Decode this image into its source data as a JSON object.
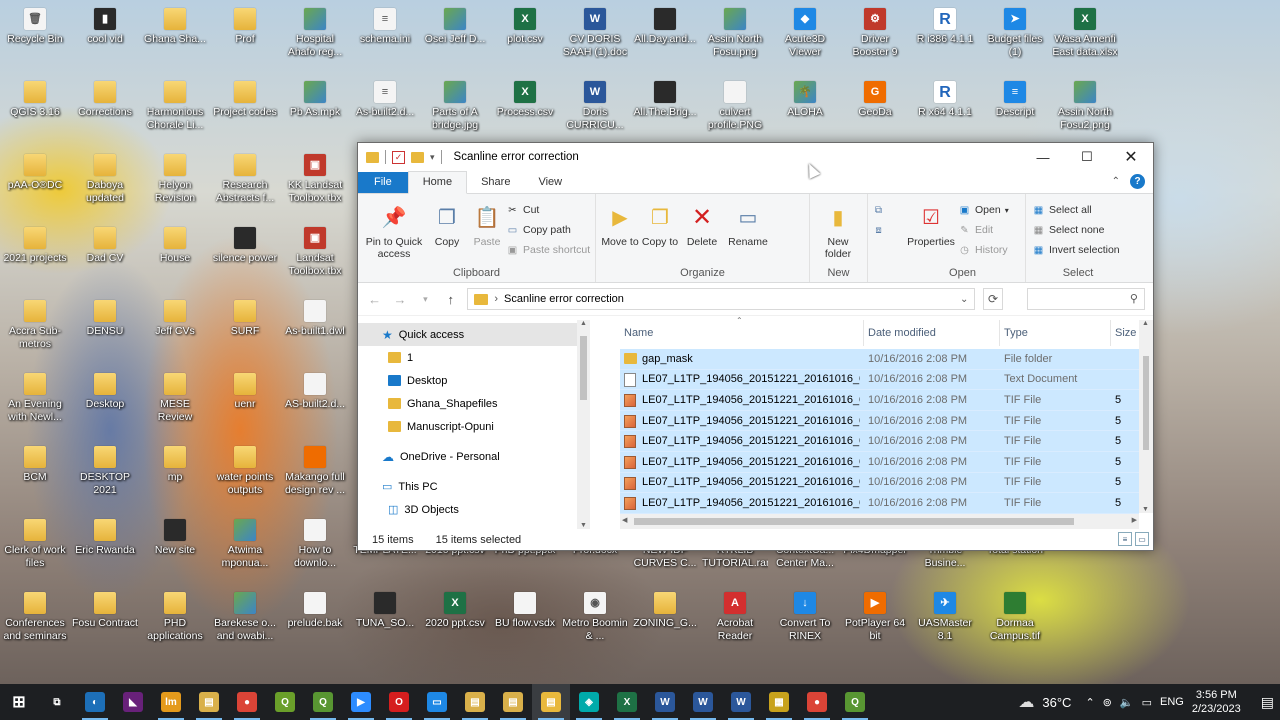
{
  "desktop": {
    "icons": [
      {
        "label": "Recycle Bin",
        "kind": "doc",
        "glyph": "🗑"
      },
      {
        "label": "cool vid",
        "kind": "dark",
        "glyph": "▮"
      },
      {
        "label": "Ghana Sha...",
        "kind": "folder",
        "glyph": ""
      },
      {
        "label": "Prof",
        "kind": "folder",
        "glyph": ""
      },
      {
        "label": "Hospital Ahafo reg...",
        "kind": "img",
        "glyph": ""
      },
      {
        "label": "schema.ini",
        "kind": "doc",
        "glyph": "≡"
      },
      {
        "label": "Osei Jeff D...",
        "kind": "img",
        "glyph": ""
      },
      {
        "label": "plot.csv",
        "kind": "excel",
        "glyph": "X"
      },
      {
        "label": "CV DORIS SAAH (1).doc",
        "kind": "word",
        "glyph": "W"
      },
      {
        "label": "All.Day.and...",
        "kind": "dark",
        "glyph": ""
      },
      {
        "label": "Assin North Fosu.png",
        "kind": "img",
        "glyph": ""
      },
      {
        "label": "Acute3D Viewer",
        "kind": "blue",
        "glyph": "◆"
      },
      {
        "label": "Driver Booster 9",
        "kind": "red",
        "glyph": "⚙"
      },
      {
        "label": "R i386 4.1.1",
        "kind": "rlogo",
        "glyph": "R"
      },
      {
        "label": "Budget files (1)",
        "kind": "blue",
        "glyph": "➤"
      },
      {
        "label": "Wasa Amenfi East data.xlsx",
        "kind": "excel",
        "glyph": "X"
      },
      {
        "label": "QGIS 3.16",
        "kind": "folder",
        "glyph": ""
      },
      {
        "label": "Corrections",
        "kind": "folder",
        "glyph": ""
      },
      {
        "label": "Harmonious Chorale Li...",
        "kind": "folder",
        "glyph": ""
      },
      {
        "label": "Project codes",
        "kind": "folder",
        "glyph": ""
      },
      {
        "label": "Pb As.mpk",
        "kind": "img",
        "glyph": ""
      },
      {
        "label": "As-built2.d...",
        "kind": "doc",
        "glyph": "≡"
      },
      {
        "label": "Parts of A bridge.jpg",
        "kind": "img",
        "glyph": ""
      },
      {
        "label": "Process.csv",
        "kind": "excel",
        "glyph": "X"
      },
      {
        "label": "Doris CURRICU...",
        "kind": "word",
        "glyph": "W"
      },
      {
        "label": "All.The.Brig...",
        "kind": "dark",
        "glyph": ""
      },
      {
        "label": "culvert profile.PNG",
        "kind": "doc",
        "glyph": ""
      },
      {
        "label": "ALOHA",
        "kind": "img",
        "glyph": "🌴"
      },
      {
        "label": "GeoDa",
        "kind": "orange",
        "glyph": "G"
      },
      {
        "label": "R x64 4.1.1",
        "kind": "rlogo",
        "glyph": "R"
      },
      {
        "label": "Descript",
        "kind": "blue",
        "glyph": "≡"
      },
      {
        "label": "Assin North Fosu2.png",
        "kind": "img",
        "glyph": ""
      },
      {
        "label": "pAA-O®DC",
        "kind": "folder",
        "glyph": ""
      },
      {
        "label": "Daboya updated",
        "kind": "folder",
        "glyph": ""
      },
      {
        "label": "Helyon Revision",
        "kind": "folder",
        "glyph": ""
      },
      {
        "label": "Research Abstracts f...",
        "kind": "folder",
        "glyph": ""
      },
      {
        "label": "KK Landsat Toolbox.tbx",
        "kind": "red",
        "glyph": "▣"
      },
      {
        "label": "2021 projects",
        "kind": "folder",
        "glyph": ""
      },
      {
        "label": "Dad CV",
        "kind": "folder",
        "glyph": ""
      },
      {
        "label": "House",
        "kind": "folder",
        "glyph": ""
      },
      {
        "label": "silence power",
        "kind": "dark",
        "glyph": ""
      },
      {
        "label": "Landsat Toolbox.tbx",
        "kind": "red",
        "glyph": "▣"
      },
      {
        "label": "Accra Sub-metros",
        "kind": "folder",
        "glyph": ""
      },
      {
        "label": "DENSU",
        "kind": "folder",
        "glyph": ""
      },
      {
        "label": "Jeff CVs",
        "kind": "folder",
        "glyph": ""
      },
      {
        "label": "SURF",
        "kind": "folder",
        "glyph": ""
      },
      {
        "label": "As-built1.dwl",
        "kind": "doc",
        "glyph": ""
      },
      {
        "label": "An Evening with Newl...",
        "kind": "folder",
        "glyph": ""
      },
      {
        "label": "Desktop",
        "kind": "folder",
        "glyph": ""
      },
      {
        "label": "MESE Review",
        "kind": "folder",
        "glyph": ""
      },
      {
        "label": "uenr",
        "kind": "folder",
        "glyph": ""
      },
      {
        "label": "AS-built2.d...",
        "kind": "doc",
        "glyph": ""
      },
      {
        "label": "BCM",
        "kind": "folder",
        "glyph": ""
      },
      {
        "label": "DESKTOP 2021",
        "kind": "folder",
        "glyph": ""
      },
      {
        "label": "mp",
        "kind": "folder",
        "glyph": ""
      },
      {
        "label": "water points outputs",
        "kind": "folder",
        "glyph": ""
      },
      {
        "label": "Makango full design rev ...",
        "kind": "orange",
        "glyph": ""
      },
      {
        "label": "Clerk of work files",
        "kind": "folder",
        "glyph": ""
      },
      {
        "label": "Eric Rwanda",
        "kind": "folder",
        "glyph": ""
      },
      {
        "label": "New site",
        "kind": "dark",
        "glyph": ""
      },
      {
        "label": "Atwima mponua...",
        "kind": "img",
        "glyph": ""
      },
      {
        "label": "How to downlo...",
        "kind": "doc",
        "glyph": ""
      },
      {
        "label": "TEMPLATE...",
        "kind": "doc",
        "glyph": ""
      },
      {
        "label": "2010 ppt.csv",
        "kind": "excel",
        "glyph": "X"
      },
      {
        "label": "PhD ppt.pptx",
        "kind": "orange",
        "glyph": "P"
      },
      {
        "label": "Prof.docx",
        "kind": "word",
        "glyph": "W"
      },
      {
        "label": "NEW IDF CURVES C...",
        "kind": "doc",
        "glyph": ""
      },
      {
        "label": "RTKLIB TUTORIAL.rar",
        "kind": "purple",
        "glyph": ""
      },
      {
        "label": "ContextCa... Center Ma...",
        "kind": "teal",
        "glyph": ""
      },
      {
        "label": "Pix4Dmapper",
        "kind": "doc",
        "glyph": ""
      },
      {
        "label": "Trimble Busine...",
        "kind": "doc",
        "glyph": ""
      },
      {
        "label": "Total station",
        "kind": "doc",
        "glyph": ""
      },
      {
        "label": "Conferences and seminars",
        "kind": "folder",
        "glyph": ""
      },
      {
        "label": "Fosu Contract",
        "kind": "folder",
        "glyph": ""
      },
      {
        "label": "PHD applications",
        "kind": "folder",
        "glyph": ""
      },
      {
        "label": "Barekese o... and owabi...",
        "kind": "img",
        "glyph": ""
      },
      {
        "label": "prelude.bak",
        "kind": "doc",
        "glyph": ""
      },
      {
        "label": "TUNA_SO...",
        "kind": "dark",
        "glyph": ""
      },
      {
        "label": "2020 ppt.csv",
        "kind": "excel",
        "glyph": "X"
      },
      {
        "label": "BU flow.vsdx",
        "kind": "doc",
        "glyph": ""
      },
      {
        "label": "Metro Boomin & ...",
        "kind": "doc",
        "glyph": "◉"
      },
      {
        "label": "ZONING_G...",
        "kind": "folder",
        "glyph": ""
      },
      {
        "label": "Acrobat Reader",
        "kind": "pdf",
        "glyph": "A"
      },
      {
        "label": "Convert To RINEX",
        "kind": "blue",
        "glyph": "↓"
      },
      {
        "label": "PotPlayer 64 bit",
        "kind": "orange",
        "glyph": "▶"
      },
      {
        "label": "UASMaster 8.1",
        "kind": "blue",
        "glyph": "✈"
      },
      {
        "label": "Dormaa Campus.tif",
        "kind": "green",
        "glyph": ""
      }
    ]
  },
  "window": {
    "title": "Scanline error correction",
    "tabs": {
      "file": "File",
      "home": "Home",
      "share": "Share",
      "view": "View"
    },
    "ribbon": {
      "pin_label": "Pin to Quick access",
      "copy_label": "Copy",
      "paste_label": "Paste",
      "cut_label": "Cut",
      "copy_path_label": "Copy path",
      "paste_shortcut_label": "Paste shortcut",
      "clipboard_label": "Clipboard",
      "move_to_label": "Move to",
      "copy_to_label": "Copy to",
      "delete_label": "Delete",
      "rename_label": "Rename",
      "organize_label": "Organize",
      "new_folder_label": "New folder",
      "new_label": "New",
      "properties_label": "Properties",
      "open_label": "Open",
      "edit_label": "Edit",
      "history_label": "History",
      "open_group_label": "Open",
      "select_all_label": "Select all",
      "select_none_label": "Select none",
      "invert_selection_label": "Invert selection",
      "select_group_label": "Select"
    },
    "address": "Scanline error correction",
    "nav": {
      "quick_access": "Quick access",
      "items": [
        "1",
        "Desktop",
        "Ghana_Shapefiles",
        "Manuscript-Opuni"
      ],
      "onedrive": "OneDrive - Personal",
      "this_pc": "This PC",
      "objects3d": "3D Objects"
    },
    "columns": {
      "name": "Name",
      "date": "Date modified",
      "type": "Type",
      "size": "Size"
    },
    "rows": [
      {
        "name": "gap_mask",
        "date": "10/16/2016 2:08 PM",
        "type": "File folder",
        "size": "",
        "icon": "folder"
      },
      {
        "name": "LE07_L1TP_194056_20151221_20161016_0...",
        "date": "10/16/2016 2:08 PM",
        "type": "Text Document",
        "size": "",
        "icon": "txt"
      },
      {
        "name": "LE07_L1TP_194056_20151221_20161016_0...",
        "date": "10/16/2016 2:08 PM",
        "type": "TIF File",
        "size": "5",
        "icon": "tif"
      },
      {
        "name": "LE07_L1TP_194056_20151221_20161016_0...",
        "date": "10/16/2016 2:08 PM",
        "type": "TIF File",
        "size": "5",
        "icon": "tif"
      },
      {
        "name": "LE07_L1TP_194056_20151221_20161016_0...",
        "date": "10/16/2016 2:08 PM",
        "type": "TIF File",
        "size": "5",
        "icon": "tif"
      },
      {
        "name": "LE07_L1TP_194056_20151221_20161016_0...",
        "date": "10/16/2016 2:08 PM",
        "type": "TIF File",
        "size": "5",
        "icon": "tif"
      },
      {
        "name": "LE07_L1TP_194056_20151221_20161016_0...",
        "date": "10/16/2016 2:08 PM",
        "type": "TIF File",
        "size": "5",
        "icon": "tif"
      },
      {
        "name": "LE07_L1TP_194056_20151221_20161016_0...",
        "date": "10/16/2016 2:08 PM",
        "type": "TIF File",
        "size": "5",
        "icon": "tif"
      }
    ],
    "status": {
      "items": "15 items",
      "selected": "15 items selected"
    }
  },
  "taskbar": {
    "apps": [
      {
        "name": "start-button",
        "glyph": "⊞",
        "color": "#1d1f22"
      },
      {
        "name": "task-view-button",
        "glyph": "⧉",
        "color": "#1d1f22"
      },
      {
        "name": "taskbar-browser-icon",
        "glyph": "◐",
        "color": "#1d6fb8"
      },
      {
        "name": "taskbar-visual-studio-icon",
        "glyph": "◣",
        "color": "#68217a"
      },
      {
        "name": "taskbar-app-orange-icon",
        "glyph": "lm",
        "color": "#e49a1c"
      },
      {
        "name": "taskbar-folder-icon",
        "glyph": "▤",
        "color": "#d9b04a"
      },
      {
        "name": "taskbar-chrome-icon",
        "glyph": "●",
        "color": "#db4437"
      },
      {
        "name": "taskbar-app-green-icon",
        "glyph": "Q",
        "color": "#6a9f2a"
      },
      {
        "name": "taskbar-qgis-icon",
        "glyph": "Q",
        "color": "#589632"
      },
      {
        "name": "taskbar-zoom-icon",
        "glyph": "▶",
        "color": "#2d8cff"
      },
      {
        "name": "taskbar-opera-icon",
        "glyph": "O",
        "color": "#d51e1e"
      },
      {
        "name": "taskbar-monitor-icon",
        "glyph": "▭",
        "color": "#1e88e5"
      },
      {
        "name": "taskbar-folder2-icon",
        "glyph": "▤",
        "color": "#d9b04a"
      },
      {
        "name": "taskbar-folder3-icon",
        "glyph": "▤",
        "color": "#d9b04a"
      },
      {
        "name": "taskbar-explorer-icon",
        "glyph": "▤",
        "color": "#e8b83c"
      },
      {
        "name": "taskbar-app-teal-icon",
        "glyph": "◈",
        "color": "#0aa"
      },
      {
        "name": "taskbar-excel-icon",
        "glyph": "X",
        "color": "#1e7145"
      },
      {
        "name": "taskbar-word-icon",
        "glyph": "W",
        "color": "#2b579a"
      },
      {
        "name": "taskbar-word2-icon",
        "glyph": "W",
        "color": "#2b579a"
      },
      {
        "name": "taskbar-word3-icon",
        "glyph": "W",
        "color": "#2b579a"
      },
      {
        "name": "taskbar-app-yellow-icon",
        "glyph": "▦",
        "color": "#c8a21c"
      },
      {
        "name": "taskbar-chrome2-icon",
        "glyph": "●",
        "color": "#db4437"
      },
      {
        "name": "taskbar-qgis2-icon",
        "glyph": "Q",
        "color": "#589632"
      }
    ],
    "temperature": "36°C",
    "language": "ENG",
    "time": "3:56 PM",
    "date": "2/23/2023"
  }
}
